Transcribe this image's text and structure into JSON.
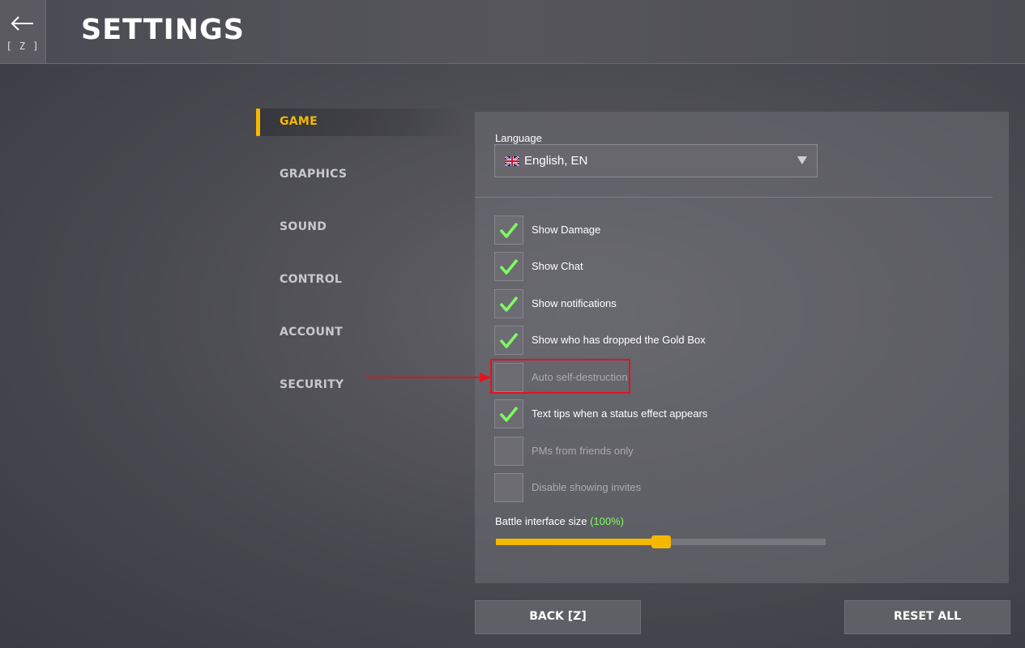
{
  "header": {
    "back_key": "[ Z ]",
    "title": "SETTINGS"
  },
  "nav": {
    "items": [
      {
        "label": "GAME",
        "active": true
      },
      {
        "label": "GRAPHICS",
        "active": false
      },
      {
        "label": "SOUND",
        "active": false
      },
      {
        "label": "CONTROL",
        "active": false
      },
      {
        "label": "ACCOUNT",
        "active": false
      },
      {
        "label": "SECURITY",
        "active": false
      }
    ]
  },
  "panel": {
    "language_label": "Language",
    "language_value": "English, EN",
    "language_flag_icon": "uk-flag-icon",
    "options": [
      {
        "label": "Show Damage",
        "checked": true
      },
      {
        "label": "Show Chat",
        "checked": true
      },
      {
        "label": "Show notifications",
        "checked": true
      },
      {
        "label": "Show who has dropped the Gold Box",
        "checked": true
      },
      {
        "label": "Auto self-destruction",
        "checked": false
      },
      {
        "label": "Text tips when a status effect appears",
        "checked": true
      },
      {
        "label": "PMs from friends only",
        "checked": false
      },
      {
        "label": "Disable showing invites",
        "checked": false
      }
    ],
    "battle_size_label": "Battle interface size",
    "battle_size_value": "(100%)",
    "battle_size_fraction": 0.5
  },
  "buttons": {
    "back_label": "BACK [Z]",
    "reset_label": "RESET ALL"
  },
  "colors": {
    "accent": "#f5b800",
    "check": "#7cff5e",
    "annotation": "#e0141d"
  }
}
